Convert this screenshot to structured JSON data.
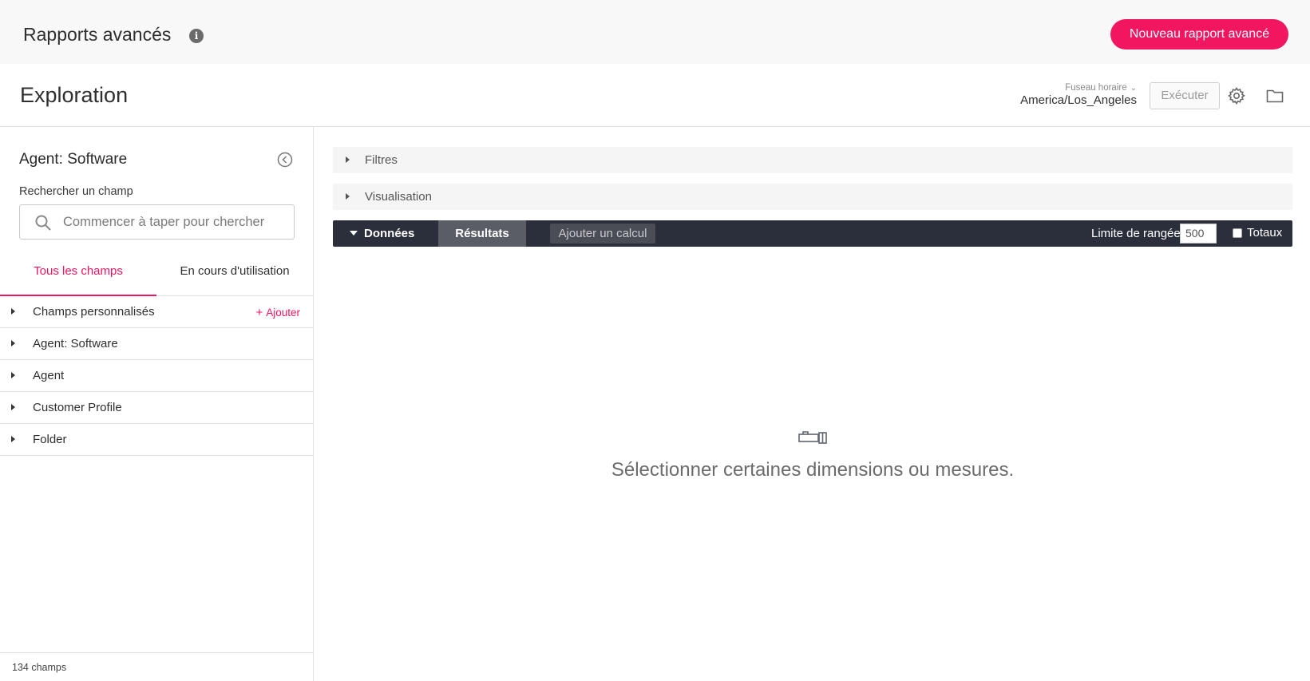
{
  "header": {
    "title": "Rapports avancés",
    "new_report_label": "Nouveau rapport avancé"
  },
  "explore": {
    "title": "Exploration",
    "timezone_label": "Fuseau horaire",
    "timezone_value": "America/Los_Angeles",
    "run_label": "Exécuter"
  },
  "sidebar": {
    "title": "Agent: Software",
    "search_label": "Rechercher un champ",
    "search_placeholder": "Commencer à taper pour chercher",
    "tabs": [
      {
        "label": "Tous les champs",
        "active": true
      },
      {
        "label": "En cours d'utilisation",
        "active": false
      }
    ],
    "fields": [
      {
        "label": "Champs personnalisés",
        "action": "Ajouter"
      },
      {
        "label": "Agent: Software"
      },
      {
        "label": "Agent"
      },
      {
        "label": "Customer Profile"
      },
      {
        "label": "Folder"
      }
    ],
    "footer": "134 champs"
  },
  "main": {
    "filters_label": "Filtres",
    "visualization_label": "Visualisation",
    "data_label": "Données",
    "results_label": "Résultats",
    "add_calc_label": "Ajouter un calcul",
    "row_limit_label": "Limite de rangée",
    "row_limit_value": "500",
    "totals_label": "Totaux",
    "totals_checked": false,
    "empty_message": "Sélectionner certaines dimensions ou mesures."
  },
  "colors": {
    "accent": "#f2155f",
    "databar": "#2b2f3b"
  }
}
